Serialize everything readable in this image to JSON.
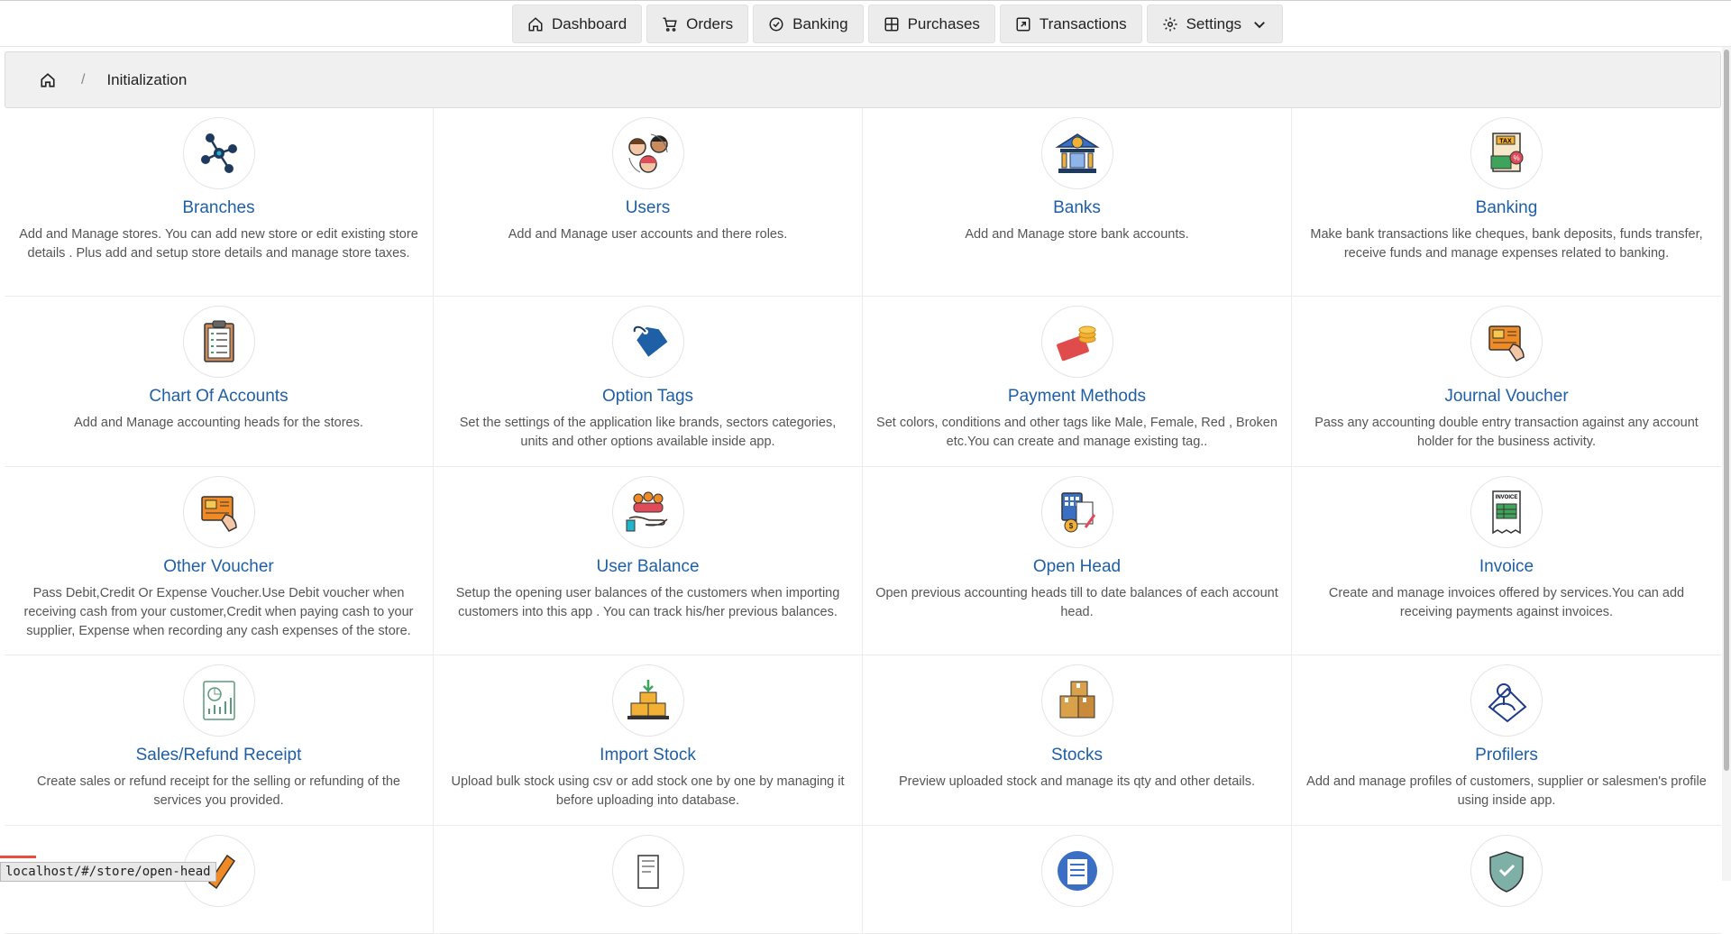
{
  "nav": {
    "items": [
      {
        "label": "Dashboard",
        "icon": "home-icon"
      },
      {
        "label": "Orders",
        "icon": "cart-icon"
      },
      {
        "label": "Banking",
        "icon": "check-circle-icon"
      },
      {
        "label": "Purchases",
        "icon": "grid-icon"
      },
      {
        "label": "Transactions",
        "icon": "external-icon"
      },
      {
        "label": "Settings",
        "icon": "gear-icon"
      }
    ]
  },
  "breadcrumb": {
    "current": "Initialization",
    "separator": "/"
  },
  "cards": [
    {
      "title": "Branches",
      "desc": "Add and Manage stores. You can add new store or edit existing store details . Plus add and setup store details and manage store taxes.",
      "icon": "network-icon"
    },
    {
      "title": "Users",
      "desc": "Add and Manage user accounts and there roles.",
      "icon": "users-icon"
    },
    {
      "title": "Banks",
      "desc": "Add and Manage store bank accounts.",
      "icon": "bank-icon"
    },
    {
      "title": "Banking",
      "desc": "Make bank transactions like cheques, bank deposits, funds transfer, receive funds and manage expenses related to banking.",
      "icon": "tax-icon"
    },
    {
      "title": "Chart Of Accounts",
      "desc": "Add and Manage accounting heads for the stores.",
      "icon": "clipboard-icon"
    },
    {
      "title": "Option Tags",
      "desc": "Set the settings of the application like brands, sectors categories, units and other options available inside app.",
      "icon": "tag-icon"
    },
    {
      "title": "Payment Methods",
      "desc": "Set colors, conditions and other tags like Male, Female, Red , Broken etc.You can create and manage existing tag..",
      "icon": "card-coins-icon"
    },
    {
      "title": "Journal Voucher",
      "desc": "Pass any accounting double entry transaction against any account holder for the business activity.",
      "icon": "voucher-hand-icon"
    },
    {
      "title": "Other Voucher",
      "desc": "Pass Debit,Credit Or Expense Voucher.Use Debit voucher when receiving cash from your customer,Credit when paying cash to your supplier, Expense when recording any cash expenses of the store.",
      "icon": "voucher-hand-icon"
    },
    {
      "title": "User Balance",
      "desc": "Setup the opening user balances of the customers when importing customers into this app . You can track his/her previous balances.",
      "icon": "hand-people-icon"
    },
    {
      "title": "Open Head",
      "desc": "Open previous accounting heads till to date balances of each account head.",
      "icon": "calculator-icon"
    },
    {
      "title": "Invoice",
      "desc": "Create and manage invoices offered by services.You can add receiving payments against invoices.",
      "icon": "invoice-icon"
    },
    {
      "title": "Sales/Refund Receipt",
      "desc": "Create sales or refund receipt for the selling or refunding of the services you provided.",
      "icon": "report-icon"
    },
    {
      "title": "Import Stock",
      "desc": "Upload bulk stock using csv or add stock one by one by managing it before uploading into database.",
      "icon": "boxes-import-icon"
    },
    {
      "title": "Stocks",
      "desc": "Preview uploaded stock and manage its qty and other details.",
      "icon": "boxes-icon"
    },
    {
      "title": "Profilers",
      "desc": "Add and manage profiles of customers, supplier or salesmen's profile using inside app.",
      "icon": "profile-icon"
    },
    {
      "title": "",
      "desc": "",
      "icon": "pen-icon"
    },
    {
      "title": "",
      "desc": "",
      "icon": "receipt-icon"
    },
    {
      "title": "",
      "desc": "",
      "icon": "list-icon"
    },
    {
      "title": "",
      "desc": "",
      "icon": "shield-icon"
    }
  ],
  "status_url": "localhost/#/store/open-head"
}
